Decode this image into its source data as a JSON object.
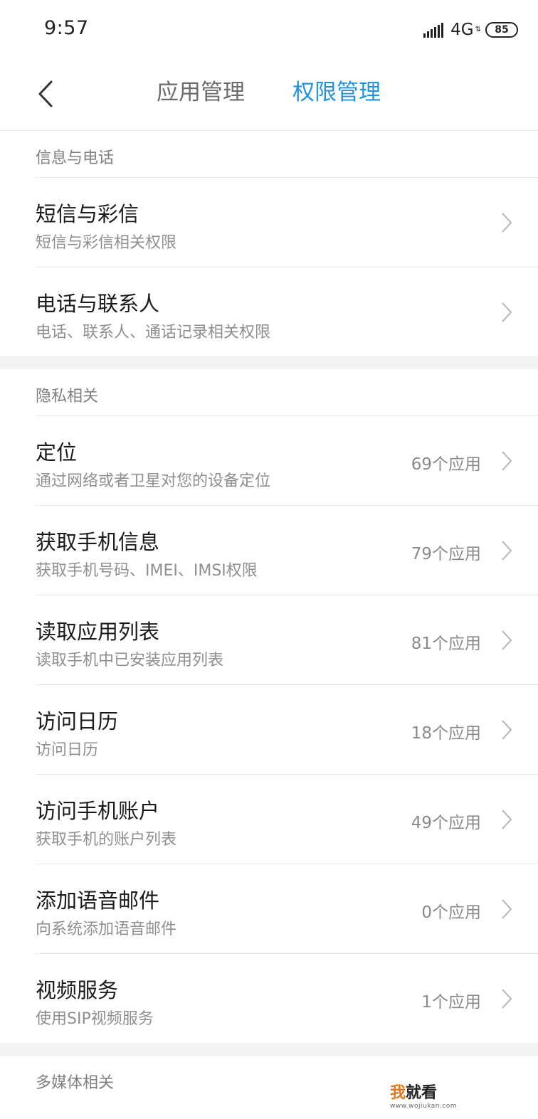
{
  "status_bar": {
    "time": "9:57",
    "network": "4G",
    "battery": "85"
  },
  "header": {
    "tabs": [
      {
        "label": "应用管理",
        "active": false
      },
      {
        "label": "权限管理",
        "active": true
      }
    ],
    "active_color": "#1f93e0"
  },
  "sections": [
    {
      "title": "信息与电话",
      "items": [
        {
          "title": "短信与彩信",
          "subtitle": "短信与彩信相关权限",
          "count": ""
        },
        {
          "title": "电话与联系人",
          "subtitle": "电话、联系人、通话记录相关权限",
          "count": ""
        }
      ]
    },
    {
      "title": "隐私相关",
      "items": [
        {
          "title": "定位",
          "subtitle": "通过网络或者卫星对您的设备定位",
          "count": "69个应用"
        },
        {
          "title": "获取手机信息",
          "subtitle": "获取手机号码、IMEI、IMSI权限",
          "count": "79个应用"
        },
        {
          "title": "读取应用列表",
          "subtitle": "读取手机中已安装应用列表",
          "count": "81个应用"
        },
        {
          "title": "访问日历",
          "subtitle": "访问日历",
          "count": "18个应用"
        },
        {
          "title": "访问手机账户",
          "subtitle": "获取手机的账户列表",
          "count": "49个应用"
        },
        {
          "title": "添加语音邮件",
          "subtitle": "向系统添加语音邮件",
          "count": "0个应用"
        },
        {
          "title": "视频服务",
          "subtitle": "使用SIP视频服务",
          "count": "1个应用"
        }
      ]
    },
    {
      "title": "多媒体相关",
      "items": []
    }
  ],
  "watermark": {
    "first_char": "我",
    "rest": "就看",
    "url": "www.wojiukan.com"
  }
}
